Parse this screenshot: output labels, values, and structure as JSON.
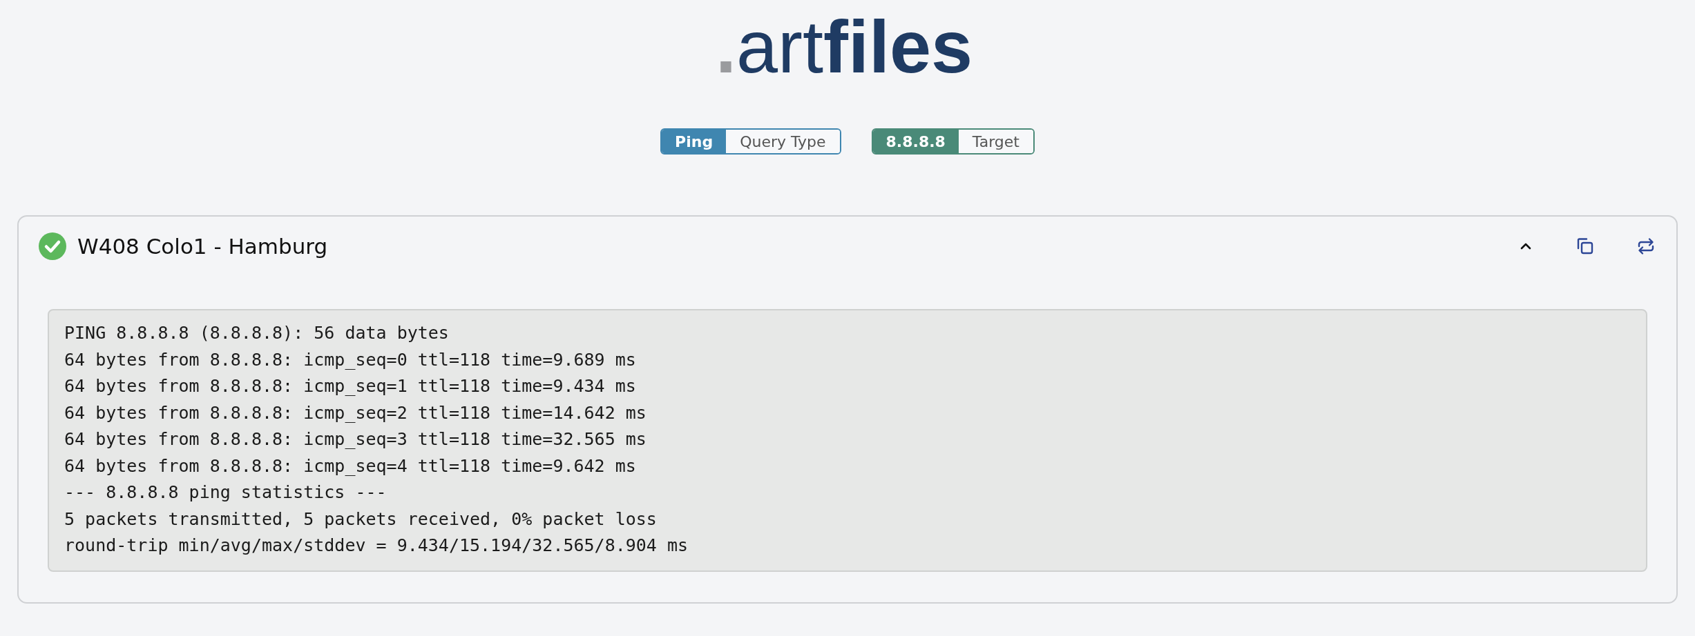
{
  "logo": {
    "parts": [
      {
        "text": ".",
        "kind": "dot"
      },
      {
        "text": "art",
        "kind": "light"
      },
      {
        "text": "files",
        "kind": "bold"
      }
    ]
  },
  "query_tags": [
    {
      "value": "Ping",
      "label": "Query Type",
      "kind": "type"
    },
    {
      "value": "8.8.8.8",
      "label": "Target",
      "kind": "target"
    }
  ],
  "result": {
    "title": "W408 Colo1 - Hamburg",
    "succeeded": true,
    "expanded": true,
    "output": [
      "PING 8.8.8.8 (8.8.8.8): 56 data bytes",
      "64 bytes from 8.8.8.8: icmp_seq=0 ttl=118 time=9.689 ms",
      "64 bytes from 8.8.8.8: icmp_seq=1 ttl=118 time=9.434 ms",
      "64 bytes from 8.8.8.8: icmp_seq=2 ttl=118 time=14.642 ms",
      "64 bytes from 8.8.8.8: icmp_seq=3 ttl=118 time=32.565 ms",
      "64 bytes from 8.8.8.8: icmp_seq=4 ttl=118 time=9.642 ms",
      "--- 8.8.8.8 ping statistics ---",
      "5 packets transmitted, 5 packets received, 0% packet loss",
      "round-trip min/avg/max/stddev = 9.434/15.194/32.565/8.904 ms"
    ]
  }
}
